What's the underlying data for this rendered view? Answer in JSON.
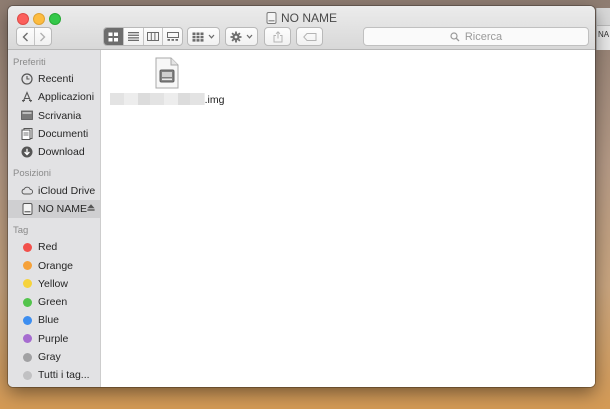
{
  "window": {
    "title": "NO NAME"
  },
  "desktop_peek": {
    "label": "NA"
  },
  "toolbar": {
    "search_placeholder": "Ricerca"
  },
  "sidebar": {
    "favorites_title": "Preferiti",
    "favorites": [
      {
        "label": "Recenti",
        "icon": "clock-icon"
      },
      {
        "label": "Applicazioni",
        "icon": "applications-icon"
      },
      {
        "label": "Scrivania",
        "icon": "desktop-icon"
      },
      {
        "label": "Documenti",
        "icon": "documents-icon"
      },
      {
        "label": "Download",
        "icon": "download-icon"
      }
    ],
    "locations_title": "Posizioni",
    "locations": [
      {
        "label": "iCloud Drive",
        "icon": "cloud-icon"
      },
      {
        "label": "NO NAME",
        "icon": "disk-icon"
      }
    ],
    "tags_title": "Tag",
    "tags": [
      {
        "label": "Red",
        "color": "#f2504b"
      },
      {
        "label": "Orange",
        "color": "#f5a13a"
      },
      {
        "label": "Yellow",
        "color": "#f6d33c"
      },
      {
        "label": "Green",
        "color": "#53c44c"
      },
      {
        "label": "Blue",
        "color": "#3d8ef0"
      },
      {
        "label": "Purple",
        "color": "#a66cd0"
      },
      {
        "label": "Gray",
        "color": "#a1a1a3"
      },
      {
        "label": "Tutti i tag...",
        "color": "#c1c1c3"
      }
    ]
  },
  "files": [
    {
      "name_suffix": ".img",
      "icon": "disk-image-icon"
    }
  ]
}
